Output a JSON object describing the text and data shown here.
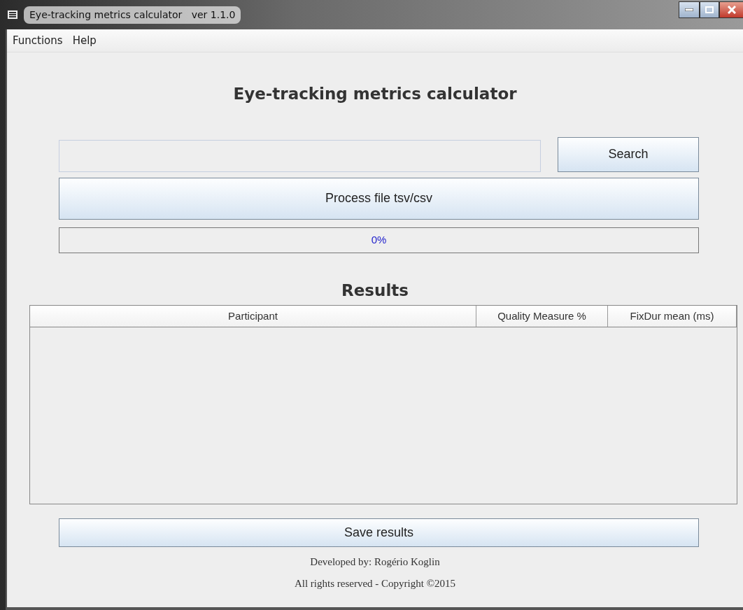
{
  "window": {
    "title": "Eye-tracking metrics calculator   ver 1.1.0"
  },
  "menu": [
    {
      "label": "Functions"
    },
    {
      "label": "Help"
    }
  ],
  "heading": "Eye-tracking metrics calculator",
  "search_button": "Search",
  "process_button": "Process file tsv/csv",
  "progress": {
    "level": 0,
    "reading": "0%"
  },
  "results_heading": "Results",
  "table": {
    "columns": [
      "Participant",
      "Quality Measure %",
      "FixDur mean (ms)"
    ]
  },
  "save_button": "Save results",
  "footer": [
    "Developed by: Rogério Koglin",
    "All rights reserved - Copyright ©2015"
  ]
}
